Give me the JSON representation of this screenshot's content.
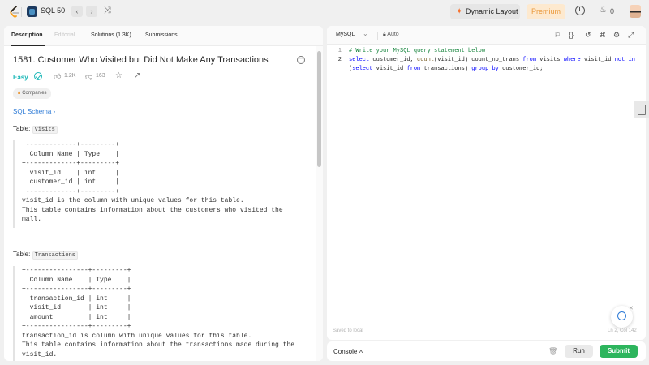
{
  "topnav": {
    "breadcrumb": "SQL 50",
    "prev": "‹",
    "next": "›",
    "shuffle": "⤨",
    "dynamic_layout": "Dynamic Layout",
    "premium": "Premium",
    "streak_count": "0"
  },
  "tabs": [
    "Description",
    "Editorial",
    "Solutions (1.3K)",
    "Submissions"
  ],
  "problem": {
    "title": "1581. Customer Who Visited but Did Not Make Any Transactions",
    "difficulty": "Easy",
    "likes": "1.2K",
    "dislikes": "163",
    "companies": "Companies",
    "schema_link": "SQL Schema",
    "table1_prefix": "Table:",
    "table1_name": "Visits",
    "table1_schema": "+-------------+---------+\n| Column Name | Type    |\n+-------------+---------+\n| visit_id    | int     |\n| customer_id | int     |\n+-------------+---------+\nvisit_id is the column with unique values for this table.\nThis table contains information about the customers who visited the\nmall.",
    "table2_prefix": "Table:",
    "table2_name": "Transactions",
    "table2_schema": "+----------------+---------+\n| Column Name    | Type    |\n+----------------+---------+\n| transaction_id | int     |\n| visit_id       | int     |\n| amount         | int     |\n+----------------+---------+\ntransaction_id is column with unique values for this table.\nThis table contains information about the transactions made during the\nvisit_id."
  },
  "editor": {
    "language": "MySQL",
    "autosave": "Auto",
    "line_numbers": [
      "1",
      "2"
    ],
    "line1": "# Write your MySQL query statement below",
    "line2": {
      "t1": "select",
      "t2": " customer_id, ",
      "t3": "count",
      "t4": "(visit_id) count_no_trans ",
      "t5": "from",
      "t6": " visits ",
      "t7": "where",
      "t8": " visit_id ",
      "t9": "not in",
      "t10": "(",
      "t11": "select",
      "t12": " visit_id ",
      "t13": "from",
      "t14": " transactions) ",
      "t15": "group by",
      "t16": " customer_id;"
    },
    "saved_status": "Saved to local",
    "cursor_position": "Ln 2, Col 142"
  },
  "bottom": {
    "console": "Console",
    "run": "Run",
    "submit": "Submit"
  },
  "colors": {
    "easy": "#1cb8b8",
    "submit": "#2db55d",
    "premium_text": "#ea9a3d",
    "link": "#2c7ad6"
  }
}
